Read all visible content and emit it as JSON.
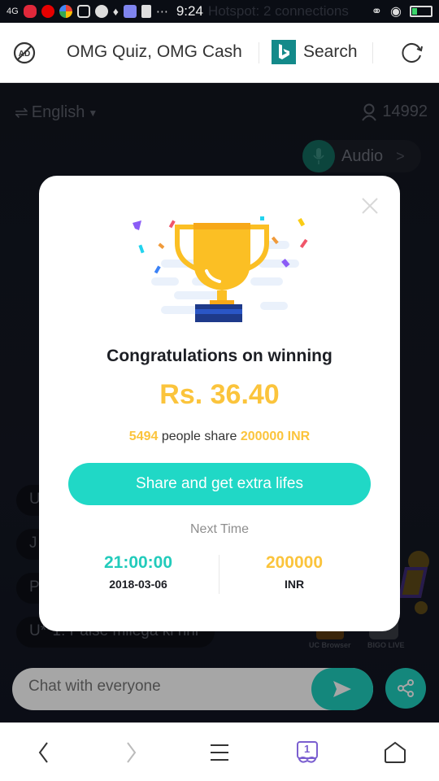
{
  "status_bar": {
    "time": "9:24",
    "ghost_text": "Hotspot: 2 connections",
    "network": "4G"
  },
  "browser": {
    "page_title": "OMG Quiz, OMG Cash",
    "search_label": "Search"
  },
  "app": {
    "language": "English",
    "online_count": "14992",
    "audio_label": "Audio",
    "chat_messages": [
      {
        "text": "U"
      },
      {
        "text": "J"
      },
      {
        "text": "P"
      },
      {
        "text": "U**1: Paise milega ki nhi"
      }
    ],
    "promos": [
      "UC Browser",
      "BIGO LIVE"
    ],
    "chat_placeholder": "Chat with everyone"
  },
  "modal": {
    "title": "Congratulations on winning",
    "amount": "Rs. 36.40",
    "share_count": "5494",
    "share_text": "people share",
    "share_pool": "200000 INR",
    "cta_label": "Share and get extra lifes",
    "next_time_label": "Next Time",
    "next_time": "21:00:00",
    "next_date": "2018-03-06",
    "next_prize": "200000",
    "next_currency": "INR"
  },
  "bottom_nav": {
    "tab_count": "1"
  },
  "colors": {
    "accent_teal": "#20d8c6",
    "gold": "#fbc43c",
    "tabs_purple": "#7b5fd0"
  }
}
